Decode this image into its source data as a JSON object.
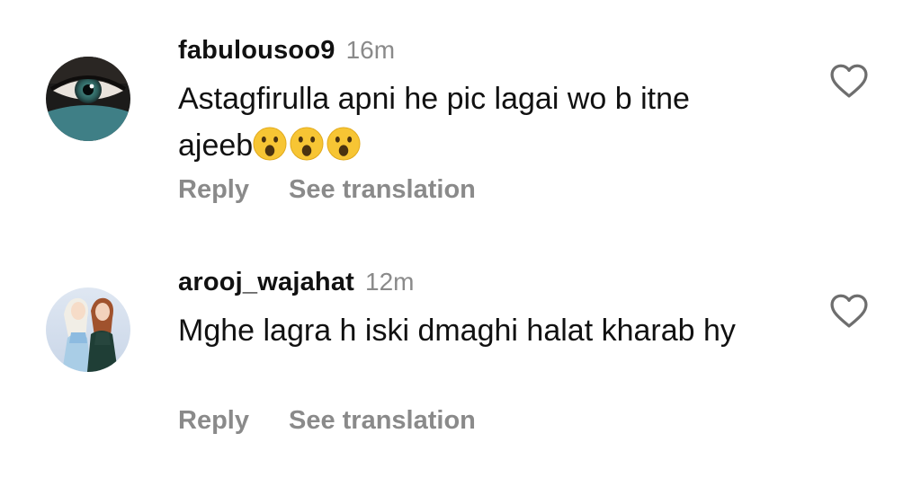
{
  "comments": [
    {
      "username": "fabulousoo9",
      "time": "16m",
      "text": "Astagfirulla apni he pic lagai wo b itne ajeeb",
      "emojis": [
        "hushed-face-emoji",
        "hushed-face-emoji",
        "hushed-face-emoji"
      ],
      "reply_label": "Reply",
      "translate_label": "See translation",
      "avatar_icon": "eye-avatar",
      "like_icon": "heart-outline-icon"
    },
    {
      "username": "arooj_wajahat",
      "time": "12m",
      "text": "Mghe lagra h iski dmaghi halat kharab hy",
      "reply_label": "Reply",
      "translate_label": "See translation",
      "avatar_icon": "two-princesses-avatar",
      "like_icon": "heart-outline-icon"
    }
  ],
  "colors": {
    "text": "#111111",
    "muted": "#8a8a8a",
    "background": "#ffffff"
  }
}
